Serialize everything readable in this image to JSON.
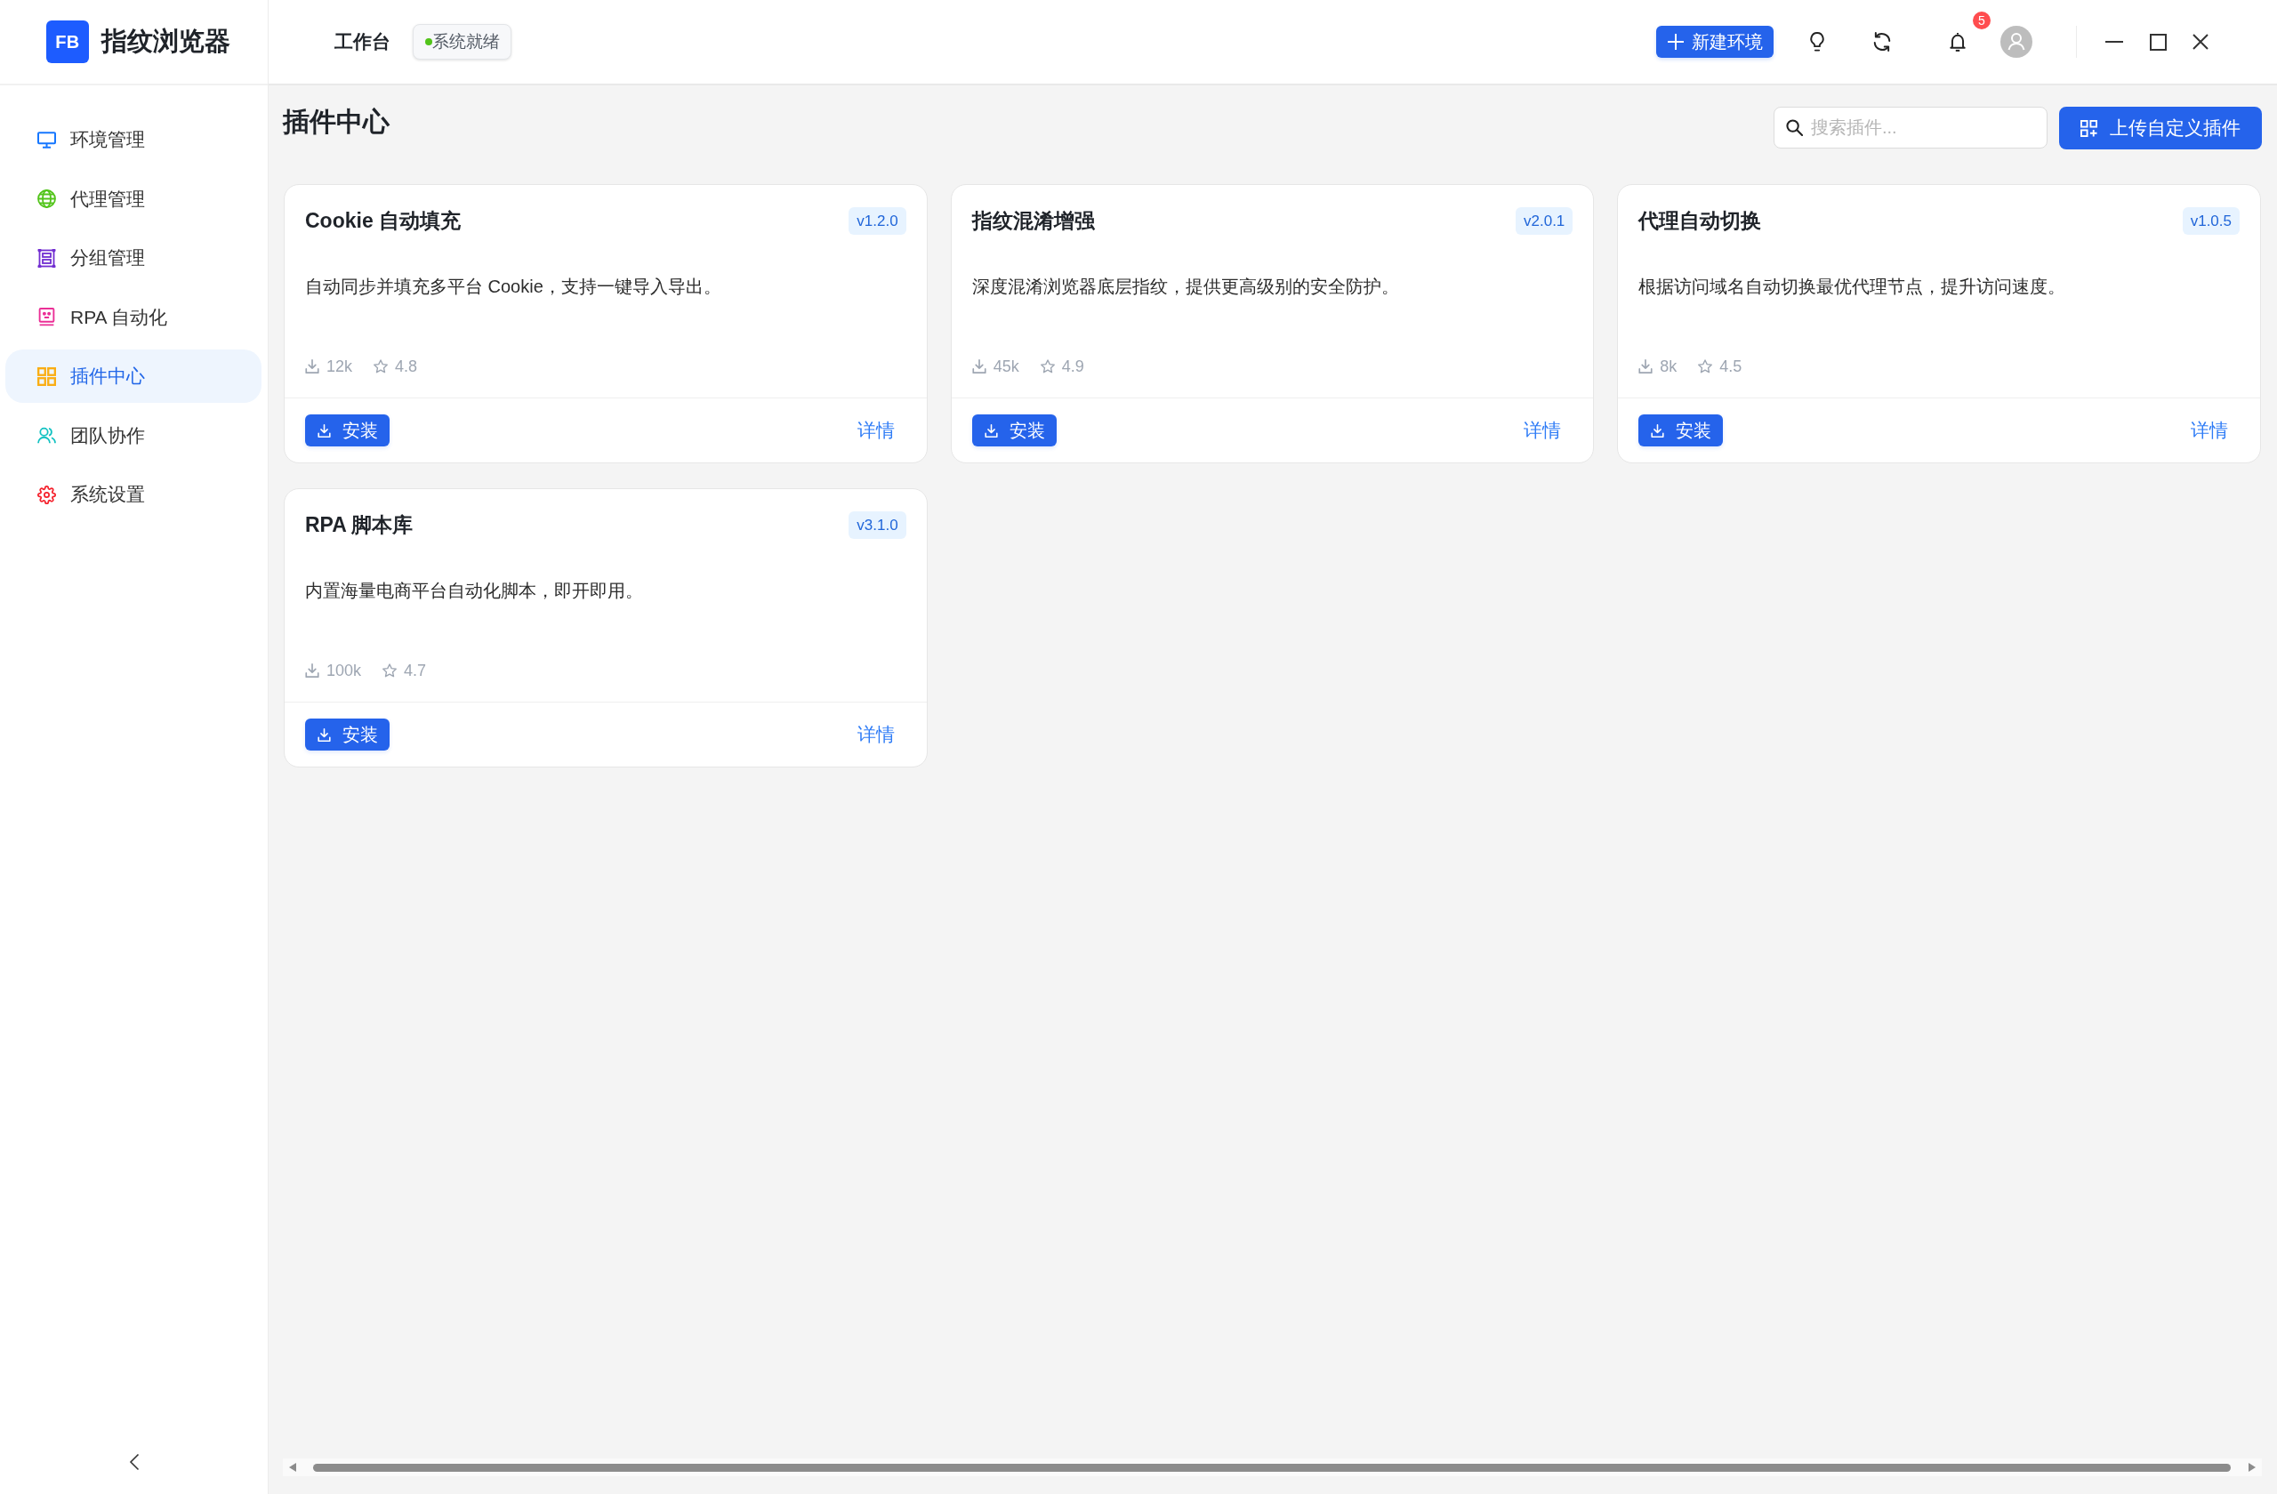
{
  "app": {
    "logo_mark": "FB",
    "name": "指纹浏览器"
  },
  "sidebar": {
    "items": [
      {
        "label": "环境管理",
        "color": "#1677ff",
        "selected": false
      },
      {
        "label": "代理管理",
        "color": "#52c41a",
        "selected": false
      },
      {
        "label": "分组管理",
        "color": "#722ed1",
        "selected": false
      },
      {
        "label": "RPA 自动化",
        "color": "#eb2f96",
        "selected": false
      },
      {
        "label": "插件中心",
        "color": "#faad14",
        "selected": true
      },
      {
        "label": "团队协作",
        "color": "#13c2c2",
        "selected": false
      },
      {
        "label": "系统设置",
        "color": "#f5222d",
        "selected": false
      }
    ]
  },
  "header": {
    "title": "工作台",
    "status": {
      "label": "系统就绪",
      "online": true
    },
    "new_button": "新建环境",
    "notifications": {
      "count": "5"
    }
  },
  "page": {
    "title": "插件中心",
    "search": {
      "placeholder": "搜索插件..."
    },
    "upload_button": "上传自定义插件"
  },
  "plugins": [
    {
      "name": "Cookie 自动填充",
      "version": "v1.2.0",
      "description": "自动同步并填充多平台 Cookie，支持一键导入导出。",
      "downloads": "12k",
      "rating": "4.8",
      "install_label": "安装",
      "details_label": "详情"
    },
    {
      "name": "指纹混淆增强",
      "version": "v2.0.1",
      "description": "深度混淆浏览器底层指纹，提供更高级别的安全防护。",
      "downloads": "45k",
      "rating": "4.9",
      "install_label": "安装",
      "details_label": "详情"
    },
    {
      "name": "代理自动切换",
      "version": "v1.0.5",
      "description": "根据访问域名自动切换最优代理节点，提升访问速度。",
      "downloads": "8k",
      "rating": "4.5",
      "install_label": "安装",
      "details_label": "详情"
    },
    {
      "name": "RPA 脚本库",
      "version": "v3.1.0",
      "description": "内置海量电商平台自动化脚本，即开即用。",
      "downloads": "100k",
      "rating": "4.7",
      "install_label": "安装",
      "details_label": "详情"
    }
  ]
}
